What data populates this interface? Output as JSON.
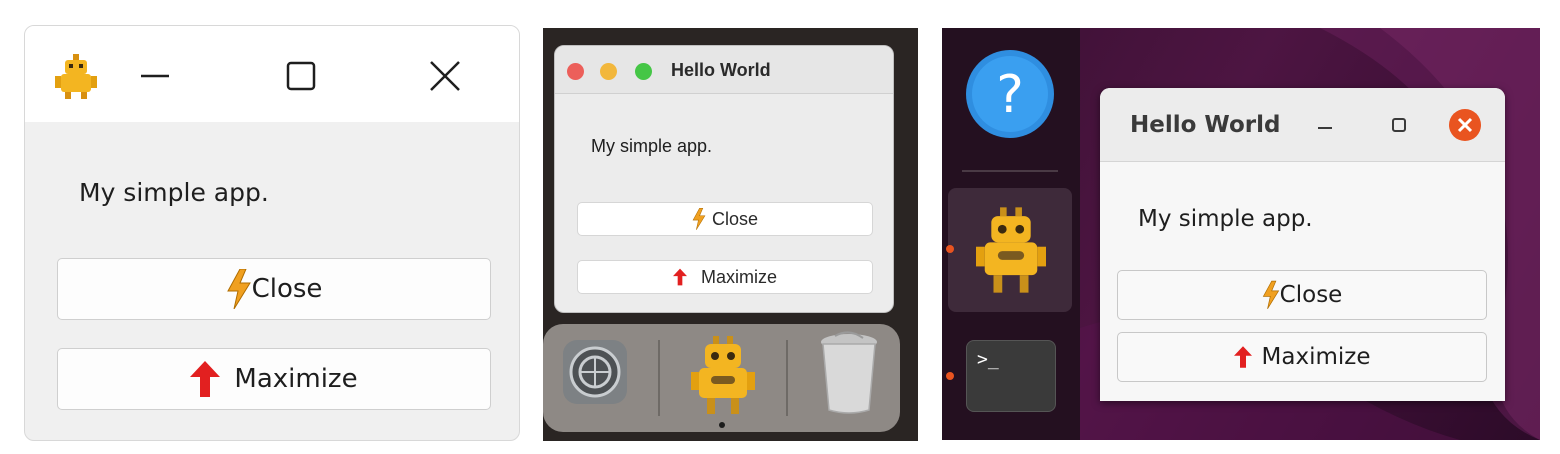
{
  "windows_panel": {
    "window_controls": {
      "minimize": "minimize-icon",
      "maximize": "maximize-icon",
      "close": "close-icon"
    },
    "app_icon": "bee-robot-icon",
    "label": "My simple app.",
    "buttons": [
      {
        "label": "Close",
        "icon": "lightning-icon"
      },
      {
        "label": "Maximize",
        "icon": "up-arrow-icon"
      }
    ]
  },
  "mac_panel": {
    "title": "Hello World",
    "label": "My simple app.",
    "buttons": [
      {
        "label": "Close",
        "icon": "lightning-icon"
      },
      {
        "label": "Maximize",
        "icon": "up-arrow-icon"
      }
    ],
    "dock": [
      "system-preferences-icon",
      "robot-app-icon",
      "trash-icon"
    ]
  },
  "ubuntu_panel": {
    "title": "Hello World",
    "label": "My simple app.",
    "buttons": [
      {
        "label": "Close",
        "icon": "lightning-icon"
      },
      {
        "label": "Maximize",
        "icon": "up-arrow-icon"
      }
    ],
    "dock": [
      "help-icon",
      "robot-app-icon",
      "terminal-icon"
    ],
    "terminal_prompt": ">_"
  },
  "colors": {
    "close_red": "#e95420",
    "mac_red": "#ec5f5a",
    "mac_yellow": "#f2b73c",
    "mac_green": "#45c646",
    "arrow_red": "#e22020",
    "lightning": "#f0a020",
    "robot_yellow": "#f3b521"
  }
}
